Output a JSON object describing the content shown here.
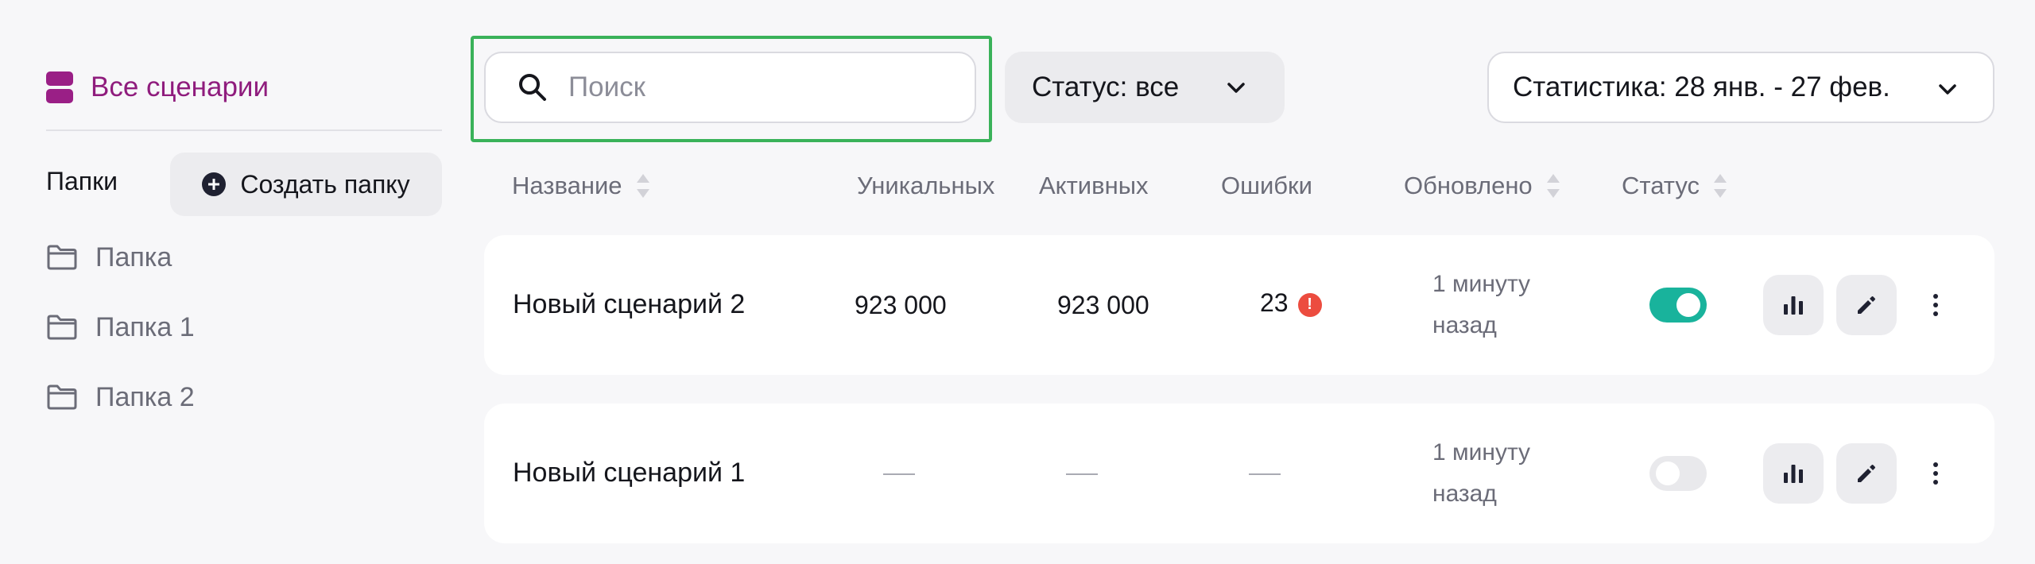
{
  "sidebar": {
    "all_scenarios": "Все сценарии",
    "folders_label": "Папки",
    "create_folder": "Создать папку",
    "folders": [
      {
        "label": "Папка"
      },
      {
        "label": "Папка 1"
      },
      {
        "label": "Папка 2"
      }
    ]
  },
  "toolbar": {
    "search_placeholder": "Поиск",
    "search_value": "",
    "status_filter": "Статус: все",
    "stats_period": "Статистика: 28 янв. - 27 фев."
  },
  "table": {
    "columns": {
      "name": "Название",
      "unique": "Уникальных",
      "active": "Активных",
      "errors": "Ошибки",
      "updated": "Обновлено",
      "status": "Статус"
    },
    "rows": [
      {
        "name": "Новый сценарий 2",
        "unique": "923 000",
        "active": "923 000",
        "errors": "23",
        "error_badge": "!",
        "updated_line1": "1 минуту",
        "updated_line2": "назад",
        "enabled": true
      },
      {
        "name": "Новый сценарий 1",
        "unique": "",
        "active": "",
        "errors": "",
        "updated_line1": "1 минуту",
        "updated_line2": "назад",
        "enabled": false
      }
    ]
  },
  "icons": {
    "sidebar_all": "stack-icon",
    "folder": "folder-icon",
    "create": "plus-circle-icon",
    "search": "search-icon",
    "chevron": "chevron-down-icon",
    "sort": "sort-icon",
    "error": "error-badge-icon",
    "stats": "bar-chart-icon",
    "edit": "pencil-icon",
    "more": "more-vertical-icon"
  },
  "colors": {
    "accent": "#8f1c7d",
    "toggle_on": "#19b39c",
    "error": "#ec4c3f",
    "highlight": "#3ab25a"
  }
}
